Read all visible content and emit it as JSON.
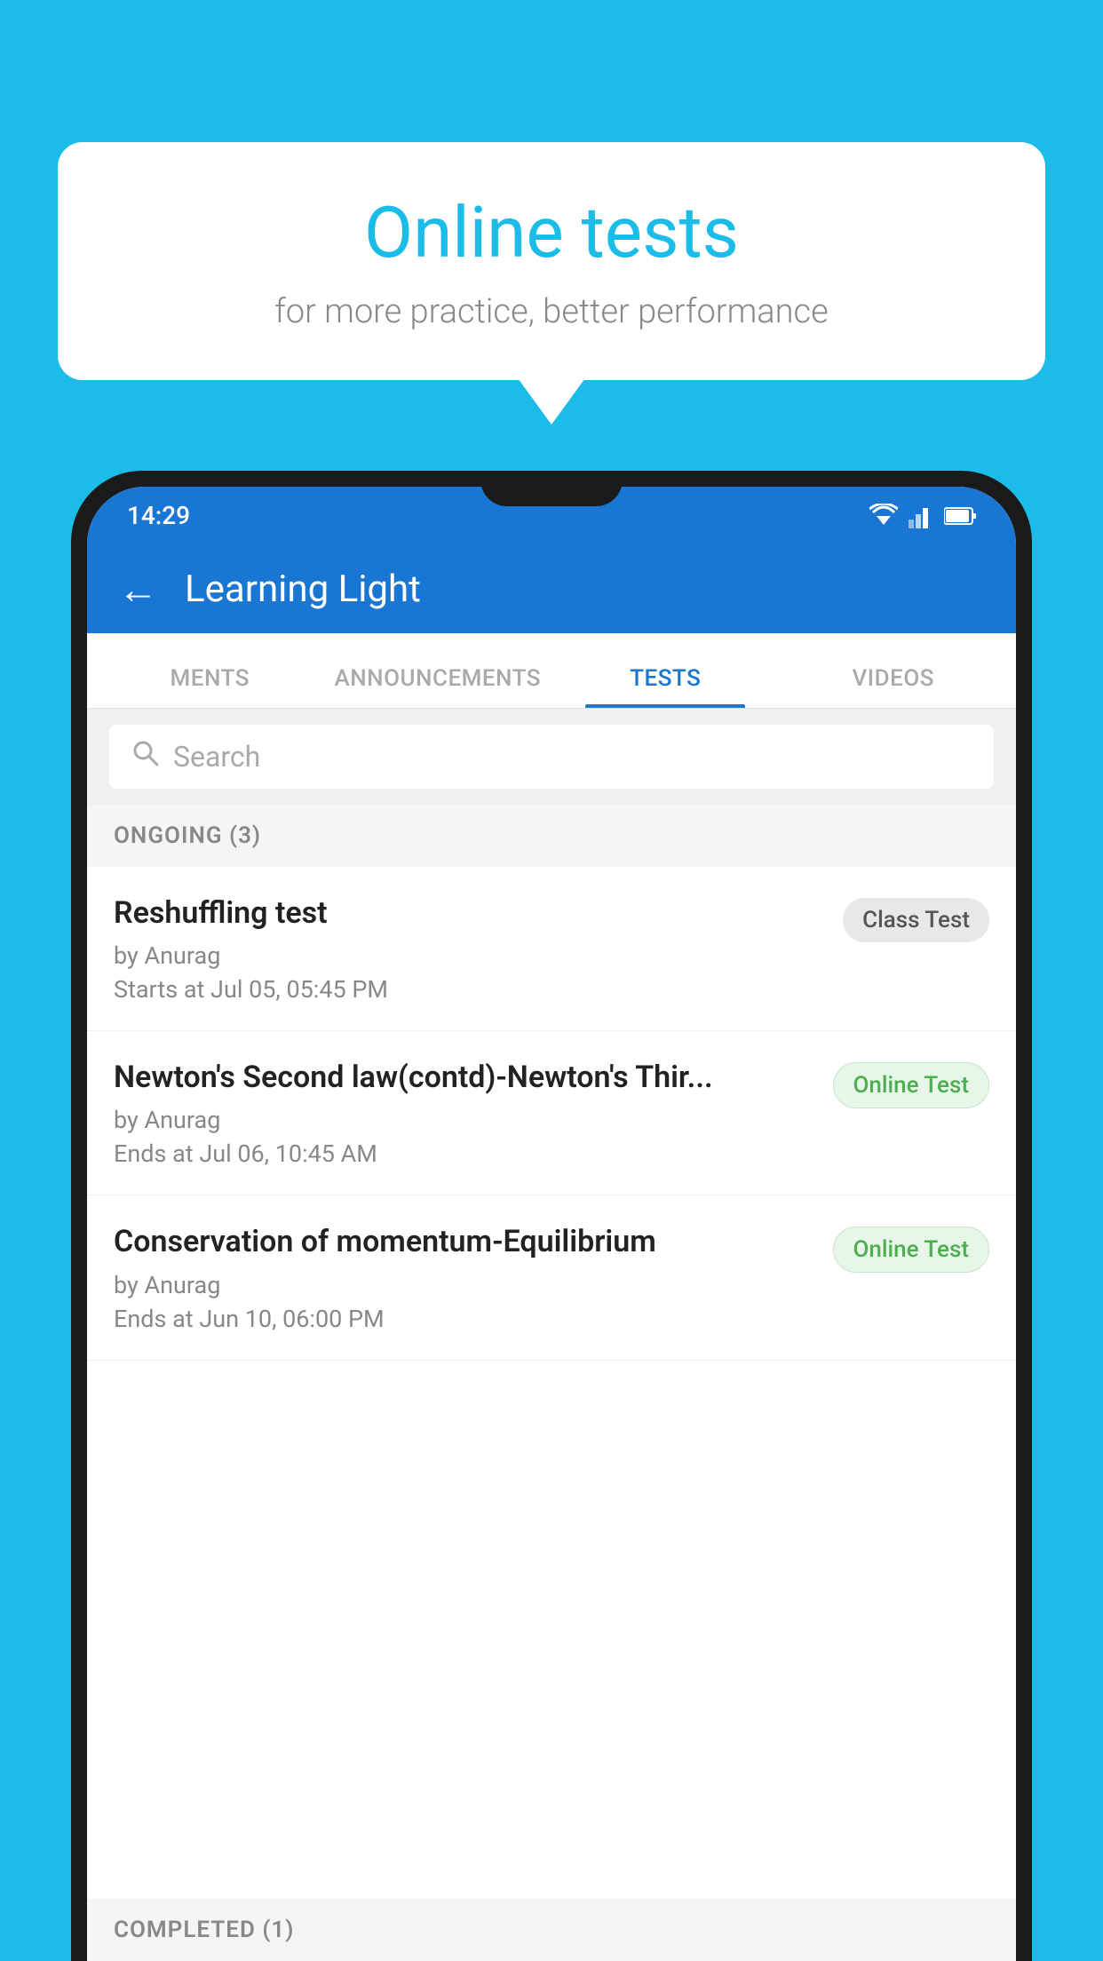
{
  "background_color": "#1BBDE8",
  "speech_bubble": {
    "title": "Online tests",
    "subtitle": "for more practice, better performance"
  },
  "status_bar": {
    "time": "14:29"
  },
  "app_bar": {
    "title": "Learning Light",
    "back_label": "←"
  },
  "tabs": [
    {
      "label": "MENTS",
      "active": false
    },
    {
      "label": "ANNOUNCEMENTS",
      "active": false
    },
    {
      "label": "TESTS",
      "active": true
    },
    {
      "label": "VIDEOS",
      "active": false
    }
  ],
  "search": {
    "placeholder": "Search"
  },
  "ongoing_section": {
    "label": "ONGOING (3)"
  },
  "tests": [
    {
      "title": "Reshuffling test",
      "by": "by Anurag",
      "date": "Starts at  Jul 05, 05:45 PM",
      "badge": "Class Test",
      "badge_type": "class"
    },
    {
      "title": "Newton's Second law(contd)-Newton's Thir...",
      "by": "by Anurag",
      "date": "Ends at  Jul 06, 10:45 AM",
      "badge": "Online Test",
      "badge_type": "online"
    },
    {
      "title": "Conservation of momentum-Equilibrium",
      "by": "by Anurag",
      "date": "Ends at  Jun 10, 06:00 PM",
      "badge": "Online Test",
      "badge_type": "online"
    }
  ],
  "completed_section": {
    "label": "COMPLETED (1)"
  }
}
